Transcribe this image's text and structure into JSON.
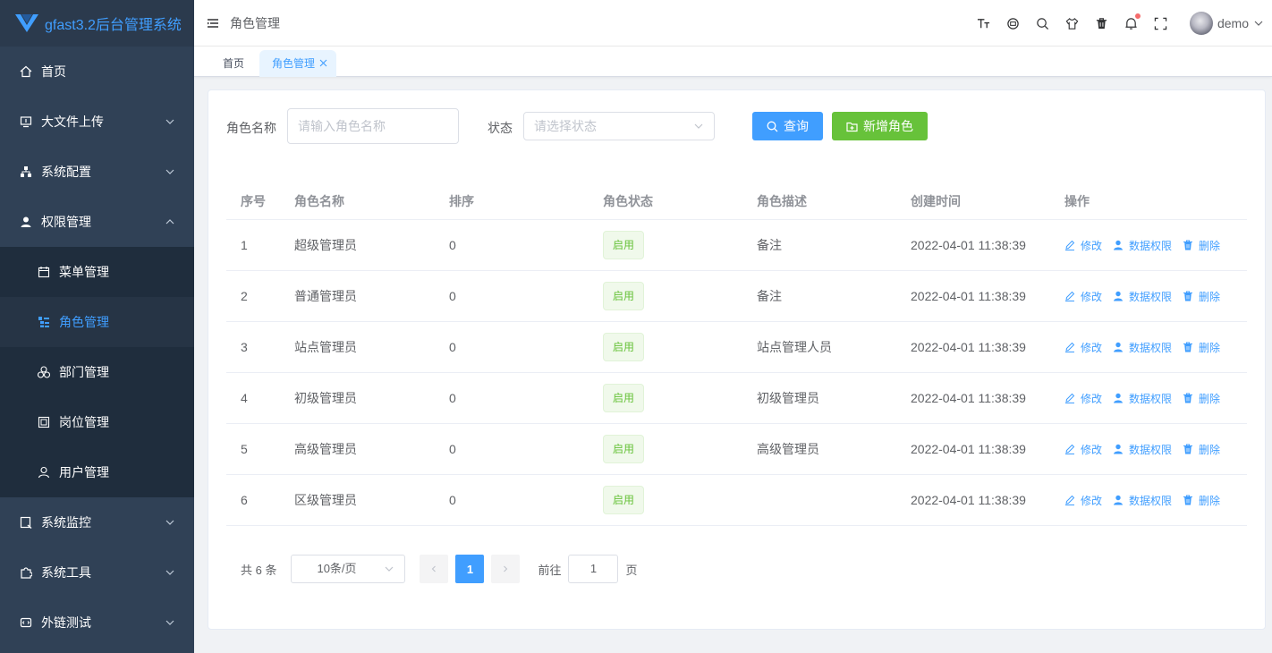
{
  "app": {
    "title": "gfast3.2后台管理系统"
  },
  "sidebar": {
    "items": [
      {
        "label": "首页"
      },
      {
        "label": "大文件上传"
      },
      {
        "label": "系统配置"
      },
      {
        "label": "权限管理"
      },
      {
        "label": "菜单管理"
      },
      {
        "label": "角色管理"
      },
      {
        "label": "部门管理"
      },
      {
        "label": "岗位管理"
      },
      {
        "label": "用户管理"
      },
      {
        "label": "系统监控"
      },
      {
        "label": "系统工具"
      },
      {
        "label": "外链测试"
      }
    ]
  },
  "header": {
    "breadcrumb": "角色管理",
    "user": "demo",
    "icons": [
      "font-size-icon",
      "layout-icon",
      "search-icon",
      "skin-icon",
      "trash-icon",
      "bell-icon",
      "fullscreen-icon"
    ],
    "notification_dot_color": "#f56c6c"
  },
  "tabs": [
    {
      "label": "首页"
    },
    {
      "label": "角色管理"
    }
  ],
  "filter": {
    "role_name_label": "角色名称",
    "role_name_placeholder": "请输入角色名称",
    "status_label": "状态",
    "status_placeholder": "请选择状态",
    "query_button": "查询",
    "add_button": "新增角色"
  },
  "table": {
    "columns": [
      "序号",
      "角色名称",
      "排序",
      "角色状态",
      "角色描述",
      "创建时间",
      "操作"
    ],
    "rows": [
      {
        "id": "1",
        "name": "超级管理员",
        "sort": "0",
        "status": "启用",
        "desc": "备注",
        "created": "2022-04-01 11:38:39"
      },
      {
        "id": "2",
        "name": "普通管理员",
        "sort": "0",
        "status": "启用",
        "desc": "备注",
        "created": "2022-04-01 11:38:39"
      },
      {
        "id": "3",
        "name": "站点管理员",
        "sort": "0",
        "status": "启用",
        "desc": "站点管理人员",
        "created": "2022-04-01 11:38:39"
      },
      {
        "id": "4",
        "name": "初级管理员",
        "sort": "0",
        "status": "启用",
        "desc": "初级管理员",
        "created": "2022-04-01 11:38:39"
      },
      {
        "id": "5",
        "name": "高级管理员",
        "sort": "0",
        "status": "启用",
        "desc": "高级管理员",
        "created": "2022-04-01 11:38:39"
      },
      {
        "id": "6",
        "name": "区级管理员",
        "sort": "0",
        "status": "启用",
        "desc": "",
        "created": "2022-04-01 11:38:39"
      }
    ],
    "actions": {
      "edit": "修改",
      "data_perm": "数据权限",
      "delete": "删除"
    }
  },
  "pagination": {
    "total": "共 6 条",
    "page_size": "10条/页",
    "current": "1",
    "goto_label": "前往",
    "goto_value": "1",
    "page_suffix": "页"
  },
  "colors": {
    "accent": "#409eff",
    "success": "#67c23a",
    "sidebar_bg": "#304156"
  }
}
